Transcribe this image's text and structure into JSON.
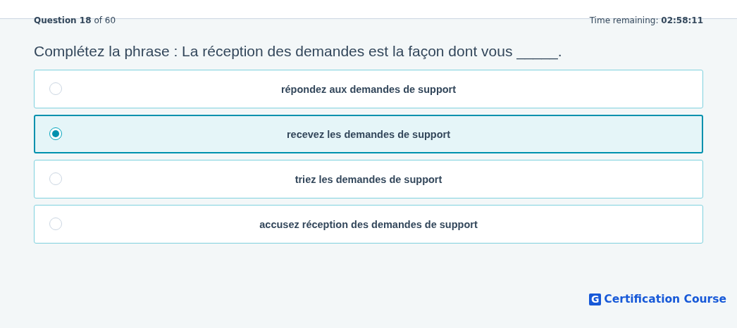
{
  "progress": {
    "label": "Question",
    "number": "18",
    "of_total": "of 60"
  },
  "timer": {
    "label": "Time remaining:",
    "value": "02:58:11"
  },
  "question": "Complétez la phrase : La réception des demandes est la façon dont vous _____.",
  "options": [
    {
      "label": "répondez aux demandes de support",
      "selected": false
    },
    {
      "label": "recevez les demandes de support",
      "selected": true
    },
    {
      "label": "triez les demandes de support",
      "selected": false
    },
    {
      "label": "accusez réception des demandes de support",
      "selected": false
    }
  ],
  "logo": {
    "mark": "G",
    "text": "Certification Course"
  }
}
